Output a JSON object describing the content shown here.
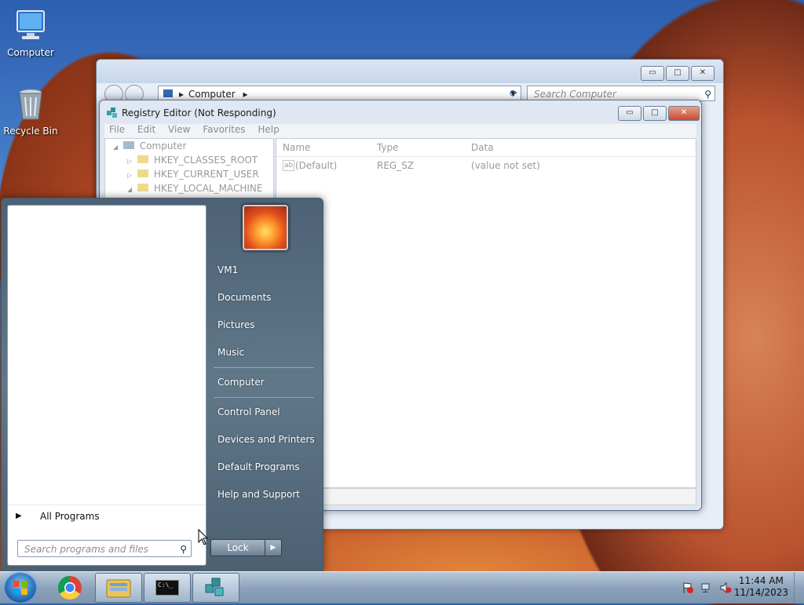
{
  "desktop": {
    "icons": [
      {
        "label": "Computer"
      },
      {
        "label": "Recycle Bin"
      }
    ]
  },
  "explorer": {
    "address": "Computer",
    "search_placeholder": "Search Computer",
    "buttons": {
      "minimize": "▭",
      "maximize": "□",
      "close": "✕"
    }
  },
  "regedit": {
    "title": "Registry Editor (Not Responding)",
    "menu": [
      "File",
      "Edit",
      "View",
      "Favorites",
      "Help"
    ],
    "tree": [
      "Computer",
      "HKEY_CLASSES_ROOT",
      "HKEY_CURRENT_USER",
      "HKEY_LOCAL_MACHINE"
    ],
    "columns": [
      "Name",
      "Type",
      "Data"
    ],
    "rows": [
      {
        "name": "(Default)",
        "type": "REG_SZ",
        "data": "(value not set)",
        "icon": "ab"
      }
    ]
  },
  "startmenu": {
    "all_programs": "All Programs",
    "search_placeholder": "Search programs and files",
    "right_items": [
      "VM1",
      "Documents",
      "Pictures",
      "Music",
      "Computer",
      "Control Panel",
      "Devices and Printers",
      "Default Programs",
      "Help and Support"
    ],
    "lock": "Lock"
  },
  "taskbar": {
    "time": "11:44 AM",
    "date": "11/14/2023",
    "cmd_glyph": "C:\\_"
  }
}
